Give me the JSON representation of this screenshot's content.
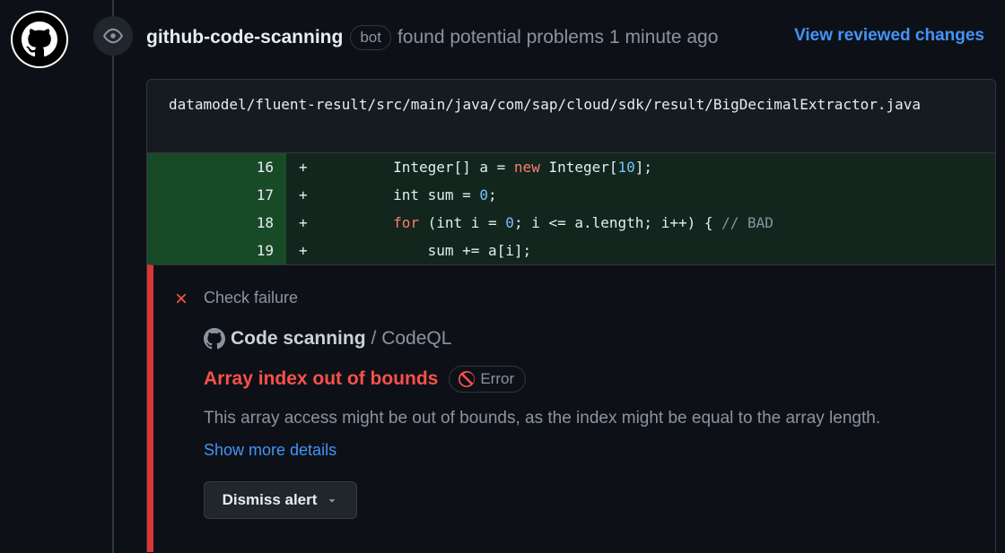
{
  "header": {
    "author": "github-code-scanning",
    "bot_badge": "bot",
    "action_text": "found potential problems",
    "time": "1 minute ago",
    "view_changes": "View reviewed changes"
  },
  "file": {
    "path": "datamodel/fluent-result/src/main/java/com/sap/cloud/sdk/result/BigDecimalExtractor.java"
  },
  "code_lines": [
    {
      "num": "16",
      "marker": "+",
      "indent": "        ",
      "tokens": [
        {
          "t": "Integer[] a = ",
          "c": ""
        },
        {
          "t": "new",
          "c": "kw"
        },
        {
          "t": " Integer[",
          "c": ""
        },
        {
          "t": "10",
          "c": "num"
        },
        {
          "t": "];",
          "c": ""
        }
      ]
    },
    {
      "num": "17",
      "marker": "+",
      "indent": "        ",
      "tokens": [
        {
          "t": "int sum = ",
          "c": ""
        },
        {
          "t": "0",
          "c": "num"
        },
        {
          "t": ";",
          "c": ""
        }
      ]
    },
    {
      "num": "18",
      "marker": "+",
      "indent": "        ",
      "tokens": [
        {
          "t": "for",
          "c": "kw"
        },
        {
          "t": " (int i = ",
          "c": ""
        },
        {
          "t": "0",
          "c": "num"
        },
        {
          "t": "; i <= a.length; i++) { ",
          "c": ""
        },
        {
          "t": "// BAD",
          "c": "cmt"
        }
      ]
    },
    {
      "num": "19",
      "marker": "+",
      "indent": "            ",
      "tokens": [
        {
          "t": "sum += a[i];",
          "c": ""
        }
      ]
    }
  ],
  "alert": {
    "check_status": "Check failure",
    "scanner_name": "Code scanning",
    "scanner_tool": "/ CodeQL",
    "title": "Array index out of bounds",
    "severity": "Error",
    "description": "This array access might be out of bounds, as the index might be equal to the array length.",
    "more_link": "Show more details",
    "dismiss_label": "Dismiss alert"
  },
  "colors": {
    "accent_link": "#4493f8",
    "danger": "#f85149",
    "added_line_bg": "#1b3a26"
  }
}
